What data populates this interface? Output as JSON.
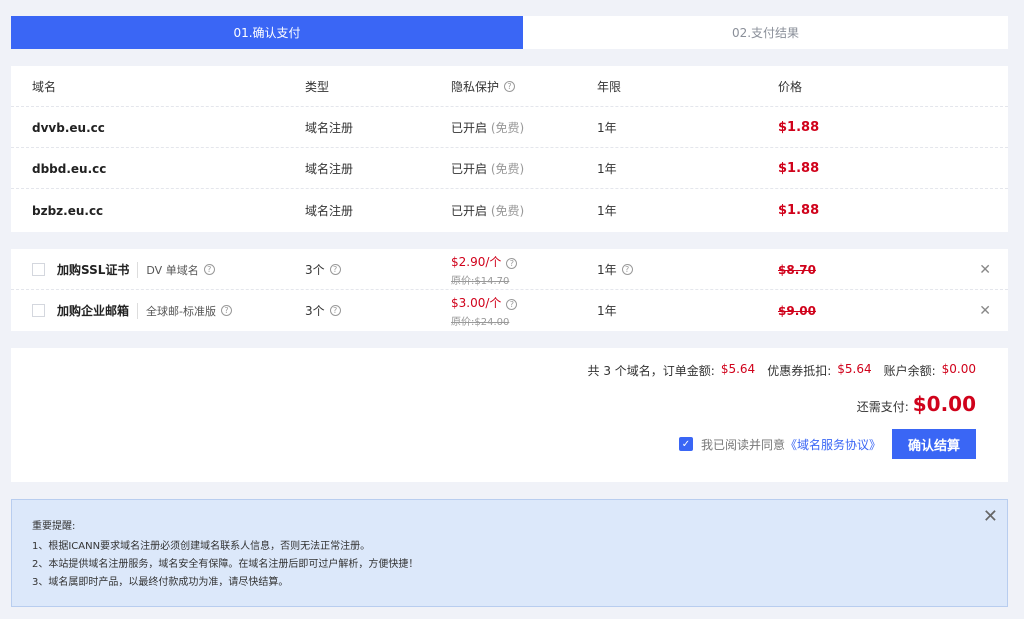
{
  "steps": {
    "active": "01.确认支付",
    "next": "02.支付结果"
  },
  "domain_table": {
    "headers": {
      "domain": "域名",
      "type": "类型",
      "privacy": "隐私保护",
      "term": "年限",
      "price": "价格"
    },
    "rows": [
      {
        "domain": "dvvb.eu.cc",
        "type": "域名注册",
        "privacy": "已开启",
        "privacy_note": "(免费)",
        "term": "1年",
        "price": "$1.88"
      },
      {
        "domain": "dbbd.eu.cc",
        "type": "域名注册",
        "privacy": "已开启",
        "privacy_note": "(免费)",
        "term": "1年",
        "price": "$1.88"
      },
      {
        "domain": "bzbz.eu.cc",
        "type": "域名注册",
        "privacy": "已开启",
        "privacy_note": "(免费)",
        "term": "1年",
        "price": "$1.88"
      }
    ]
  },
  "addons": [
    {
      "title": "加购SSL证书",
      "subtype": "DV 单域名",
      "qty": "3个",
      "unit_price": "$2.90/个",
      "orig_price": "原价:$14.70",
      "term": "1年",
      "total": "$8.70"
    },
    {
      "title": "加购企业邮箱",
      "subtype": "全球邮-标准版",
      "qty": "3个",
      "unit_price": "$3.00/个",
      "orig_price": "原价:$24.00",
      "term": "1年",
      "total": "$9.00"
    }
  ],
  "summary": {
    "count_text": "共 3 个域名，",
    "order_label": "订单金额:",
    "order_amount": "$5.64",
    "coupon_label": "优惠券抵扣:",
    "coupon_amount": "$5.64",
    "balance_label": "账户余额:",
    "balance_amount": "$0.00",
    "due_label": "还需支付:",
    "due_amount": "$0.00",
    "agree_text": "我已阅读并同意",
    "agree_link": "《域名服务协议》",
    "confirm_button": "确认结算"
  },
  "notice": {
    "title": "重要提醒:",
    "lines": [
      "1、根据ICANN要求域名注册必须创建域名联系人信息，否则无法正常注册。",
      "2、本站提供域名注册服务，域名安全有保障。在域名注册后即可过户解析，方便快捷！",
      "3、域名属即时产品，以最终付款成功为准，请尽快结算。"
    ]
  },
  "colors": {
    "accent": "#3a66f5",
    "price": "#d0021b"
  }
}
